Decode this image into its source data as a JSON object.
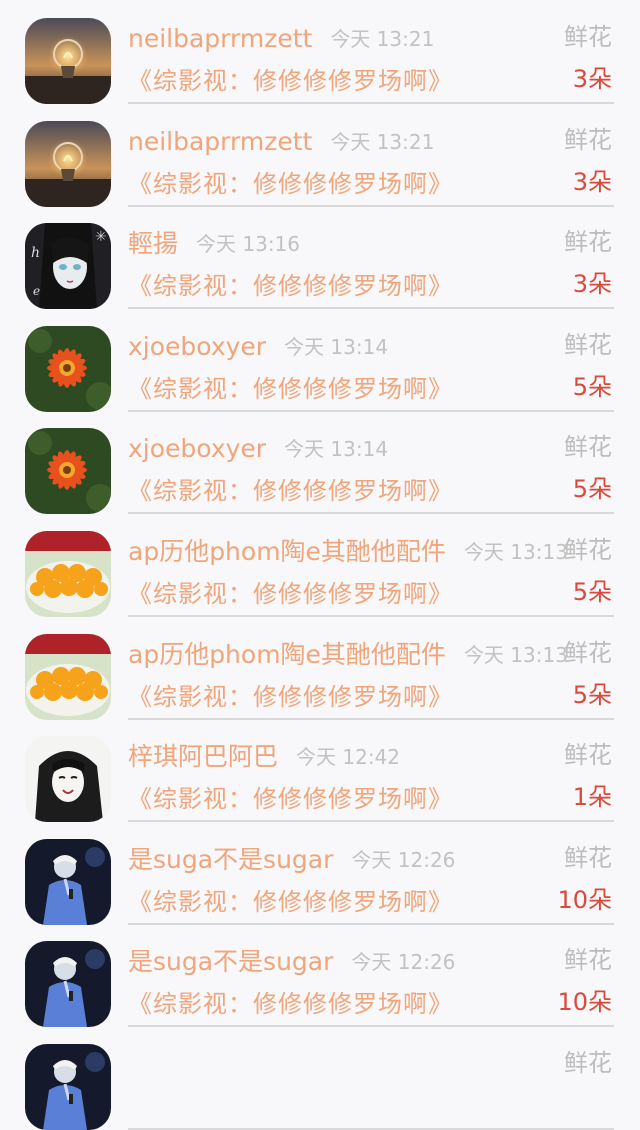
{
  "rows": [
    {
      "username": "neilbaprrmzett",
      "time": "今天 13:21",
      "type": "鲜花",
      "work": "《综影视：修修修修罗场啊》",
      "count": "3朵",
      "avatar": "bulb-avatar"
    },
    {
      "username": "neilbaprrmzett",
      "time": "今天 13:21",
      "type": "鲜花",
      "work": "《综影视：修修修修罗场啊》",
      "count": "3朵",
      "avatar": "bulb-avatar"
    },
    {
      "username": "輕揚",
      "time": "今天 13:16",
      "type": "鲜花",
      "work": "《综影视：修修修修罗场啊》",
      "count": "3朵",
      "avatar": "anime-portrait-avatar"
    },
    {
      "username": "xjoeboxyer",
      "time": "今天 13:14",
      "type": "鲜花",
      "work": "《综影视：修修修修罗场啊》",
      "count": "5朵",
      "avatar": "orange-flower-avatar"
    },
    {
      "username": "xjoeboxyer",
      "time": "今天 13:14",
      "type": "鲜花",
      "work": "《综影视：修修修修罗场啊》",
      "count": "5朵",
      "avatar": "orange-flower-avatar"
    },
    {
      "username": "ap历他phom陶e其酏他配件",
      "time": "今天 13:13",
      "type": "鲜花",
      "work": "《综影视：修修修修罗场啊》",
      "count": "5朵",
      "avatar": "mango-avatar"
    },
    {
      "username": "ap历他phom陶e其酏他配件",
      "time": "今天 13:13",
      "type": "鲜花",
      "work": "《综影视：修修修修罗场啊》",
      "count": "5朵",
      "avatar": "mango-avatar"
    },
    {
      "username": "梓琪阿巴阿巴",
      "time": "今天 12:42",
      "type": "鲜花",
      "work": "《综影视：修修修修罗场啊》",
      "count": "1朵",
      "avatar": "sketch-portrait-avatar"
    },
    {
      "username": "是suga不是sugar",
      "time": "今天 12:26",
      "type": "鲜花",
      "work": "《综影视：修修修修罗场啊》",
      "count": "10朵",
      "avatar": "singer-avatar"
    },
    {
      "username": "是suga不是sugar",
      "time": "今天 12:26",
      "type": "鲜花",
      "work": "《综影视：修修修修罗场啊》",
      "count": "10朵",
      "avatar": "singer-avatar"
    },
    {
      "username": "",
      "time": "",
      "type": "鲜花",
      "work": "",
      "count": "",
      "avatar": "singer-avatar"
    }
  ],
  "colors": {
    "accent": "#f0a57a",
    "count": "#d94a3c",
    "muted": "#c2c2c2",
    "divider": "#d9d9d9"
  }
}
